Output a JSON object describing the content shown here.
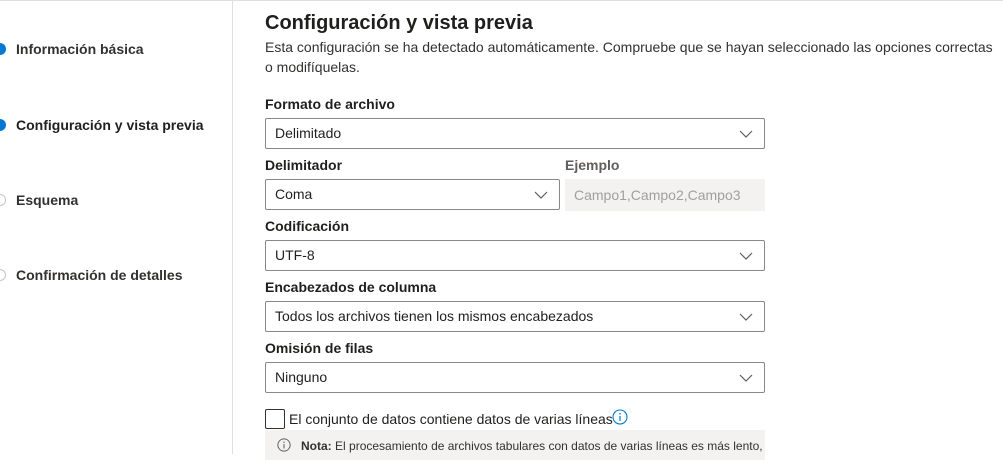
{
  "steps": [
    {
      "label": "Información básica",
      "state": "completed"
    },
    {
      "label": "Configuración y vista previa",
      "state": "current"
    },
    {
      "label": "Esquema",
      "state": "pending"
    },
    {
      "label": "Confirmación de detalles",
      "state": "pending"
    }
  ],
  "page": {
    "title": "Configuración y vista previa",
    "description": "Esta configuración se ha detectado automáticamente. Compruebe que se hayan seleccionado las opciones correctas o modifíquelas."
  },
  "fields": {
    "file_format": {
      "label": "Formato de archivo",
      "value": "Delimitado"
    },
    "delimiter": {
      "label": "Delimitador",
      "value": "Coma"
    },
    "example": {
      "label": "Ejemplo",
      "value": "Campo1,Campo2,Campo3"
    },
    "encoding": {
      "label": "Codificación",
      "value": "UTF-8"
    },
    "column_headers": {
      "label": "Encabezados de columna",
      "value": "Todos los archivos tienen los mismos encabezados"
    },
    "skip_rows": {
      "label": "Omisión de filas",
      "value": "Ninguno"
    }
  },
  "multiline": {
    "label": "El conjunto de datos contiene datos de varias líneas",
    "checked": false
  },
  "note": {
    "prefix": "Nota:",
    "text": "El procesamiento de archivos tabulares con datos de varias líneas es más lento,"
  },
  "icons": {
    "step_active": "filled-circle-icon",
    "step_idle": "circle-icon",
    "dropdown": "chevron-down-icon",
    "info": "info-icon"
  },
  "colors": {
    "accent": "#0078d4",
    "border": "#8a8886",
    "readonly_bg": "#f3f2f1"
  }
}
